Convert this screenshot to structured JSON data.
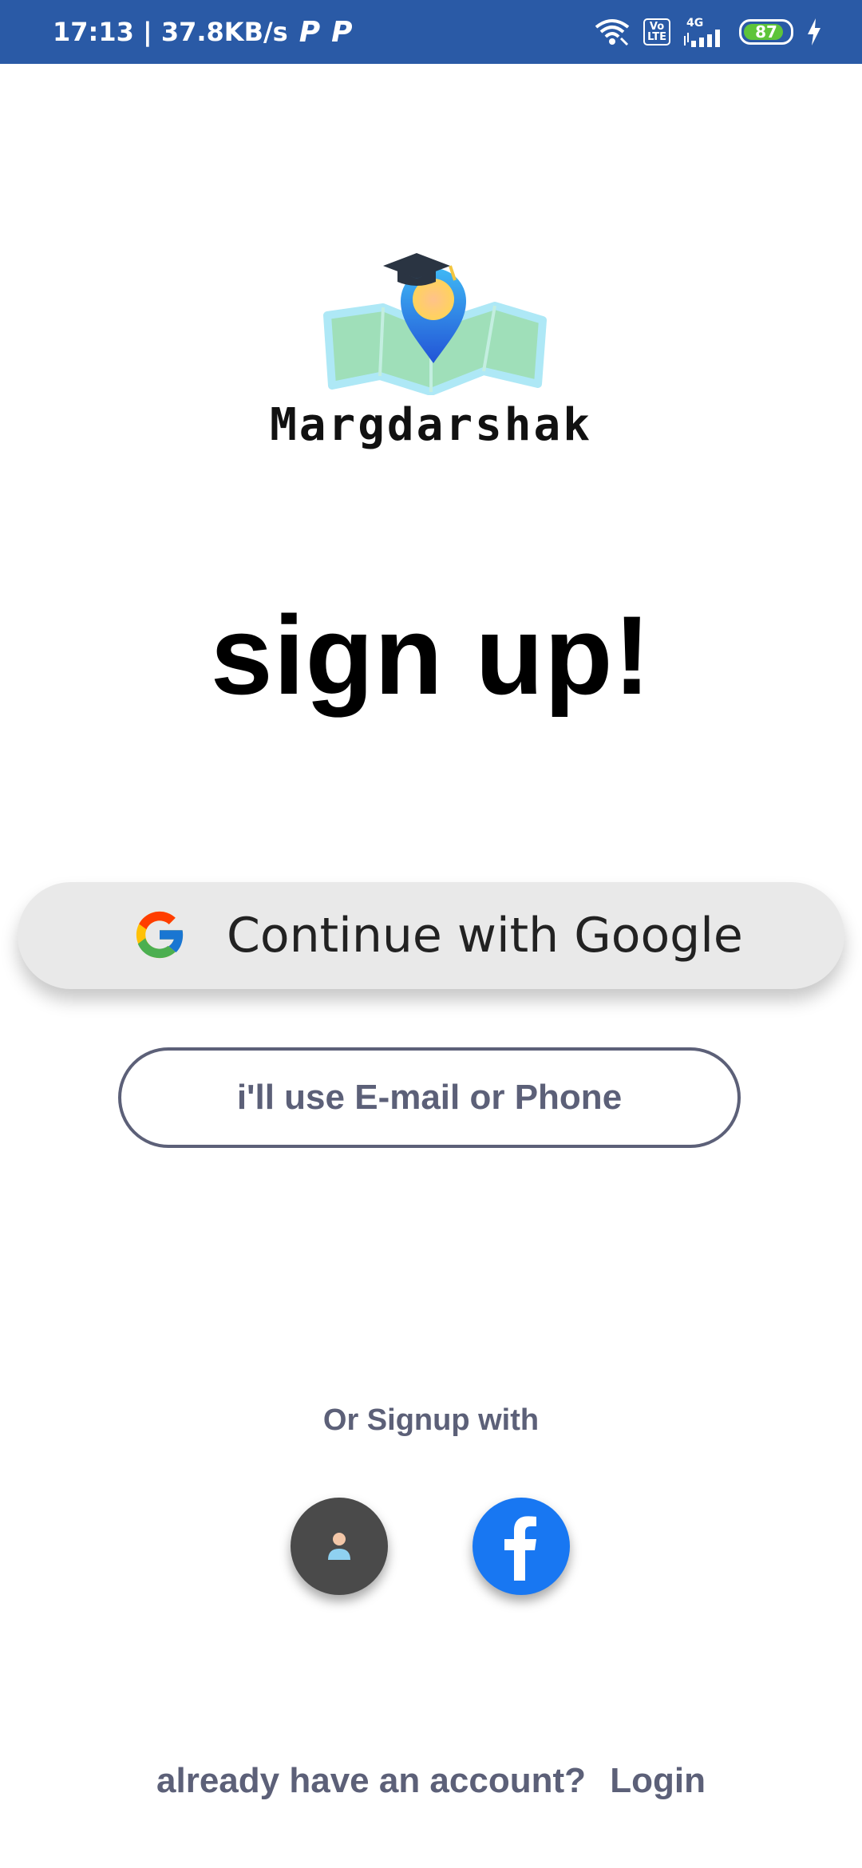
{
  "status_bar": {
    "time_speed": "17:13 | 37.8KB/s",
    "p_icon": "P",
    "volte": "Vo\nLTE",
    "network": "4G",
    "battery": "87"
  },
  "logo": {
    "brand": "Margdarshak"
  },
  "heading": "sign up!",
  "google_button": {
    "label": "Continue with Google"
  },
  "email_button": {
    "label": "i'll use E-mail or Phone"
  },
  "alt_signup": {
    "label": "Or Signup with",
    "buttons": [
      "guest-user-icon",
      "facebook-icon"
    ]
  },
  "footer": {
    "prompt": "already have an account?",
    "login_label": "Login"
  },
  "colors": {
    "status_bar": "#2a5aa6",
    "accent_text": "#5c6078",
    "facebook": "#1877f2",
    "guest": "#4a4a4a"
  }
}
